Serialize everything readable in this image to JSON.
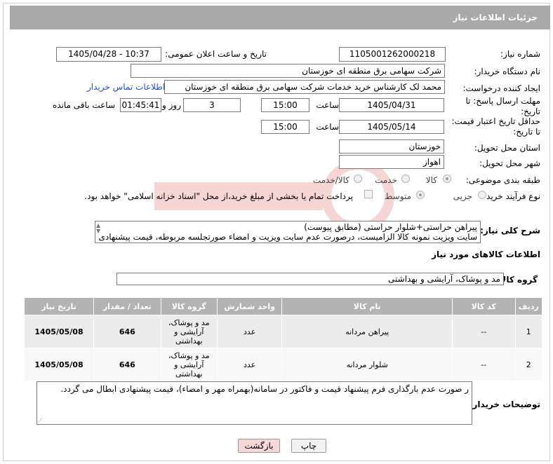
{
  "header": {
    "title": "جزئیات اطلاعات نیاز"
  },
  "fields": {
    "need_number_label": "شماره نیاز:",
    "need_number": "1105001262000218",
    "announce_label": "تاریخ و ساعت اعلان عمومی:",
    "announce_value": "1405/04/28 - 10:37",
    "buyer_org_label": "نام دستگاه خریدار:",
    "buyer_org": "شرکت سهامی برق منطقه ای خوزستان",
    "creator_label": "ایجاد کننده درخواست:",
    "creator": "محمد لک کارشناس خرید خدمات شرکت سهامی برق منطقه ای خوزستان",
    "contact_link": "اطلاعات تماس خریدار",
    "deadline_label_1": "مهلت ارسال پاسخ: تا",
    "deadline_label_2": "تاریخ:",
    "deadline_date": "1405/04/31",
    "time_label": "ساعت",
    "deadline_time": "15:00",
    "days_value": "3",
    "days_label": "روز و",
    "remaining_time": "01:45:41",
    "remaining_label": "ساعت باقی مانده",
    "validity_label_1": "حداقل تاریخ اعتبار قیمت:",
    "validity_label_2": "تا تاریخ:",
    "validity_date": "1405/05/14",
    "validity_time": "15:00",
    "province_label": "استان محل تحویل:",
    "province": "خوزستان",
    "city_label": "شهر محل تحویل:",
    "city": "اهواز",
    "category_label": "طبقه بندی موضوعی:",
    "category_options": [
      "کالا",
      "خدمت",
      "کالا/خدمت"
    ],
    "process_label": "نوع فرآیند خرید :",
    "process_options": [
      "جزیی",
      "متوسط"
    ],
    "payment_note": "پرداخت تمام یا بخشی از مبلغ خرید،از محل \"اسناد خزانه اسلامی\" خواهد بود."
  },
  "description": {
    "label": "شرح کلی نیاز:",
    "line1": "پیراهن حراستی+شلوار حراستی (مطابق پیوست)",
    "line2": "سایت ویزیت نمونه کالا الزامیست، درصورت عدم سایت ویزیت و امضاء صورتجلسه مربوطه، قیمت پیشنهادی"
  },
  "goods_info": {
    "title": "اطلاعات کالاهای مورد نیاز",
    "group_label": "گروه کالا:",
    "group_value": "مد و پوشاک، آرایشی و بهداشتی"
  },
  "table": {
    "headers": [
      "ردیف",
      "کد کالا",
      "نام کالا",
      "واحد شمارش",
      "گروه کالا",
      "تعداد / مقدار",
      "تاریخ نیاز"
    ],
    "rows": [
      {
        "row": "1",
        "code": "--",
        "name": "پیراهن مردانه",
        "unit": "عدد",
        "group": "مد و پوشاک، آرایشی و بهداشتی",
        "qty": "646",
        "date": "1405/05/08"
      },
      {
        "row": "2",
        "code": "--",
        "name": "شلوار مردانه",
        "unit": "عدد",
        "group": "مد و پوشاک، آرایشی و بهداشتی",
        "qty": "646",
        "date": "1405/05/08"
      }
    ]
  },
  "buyer_notes": {
    "label": "توضیحات خریدار:",
    "text": "ر صورت عدم بارگذاری فرم پیشنهاد قیمت و فاکتور در سامانه(بهمراه مهر و امضاء)، قیمت پیشنهادی ابطال می گردد."
  },
  "buttons": {
    "print": "چاپ",
    "back": "بازگشت"
  },
  "colors": {
    "header_bg": "#a9a9a9",
    "table_header_bg": "#b3b3b3",
    "link": "#1f4fd6",
    "back_button_bg": "#f7d8d8"
  }
}
